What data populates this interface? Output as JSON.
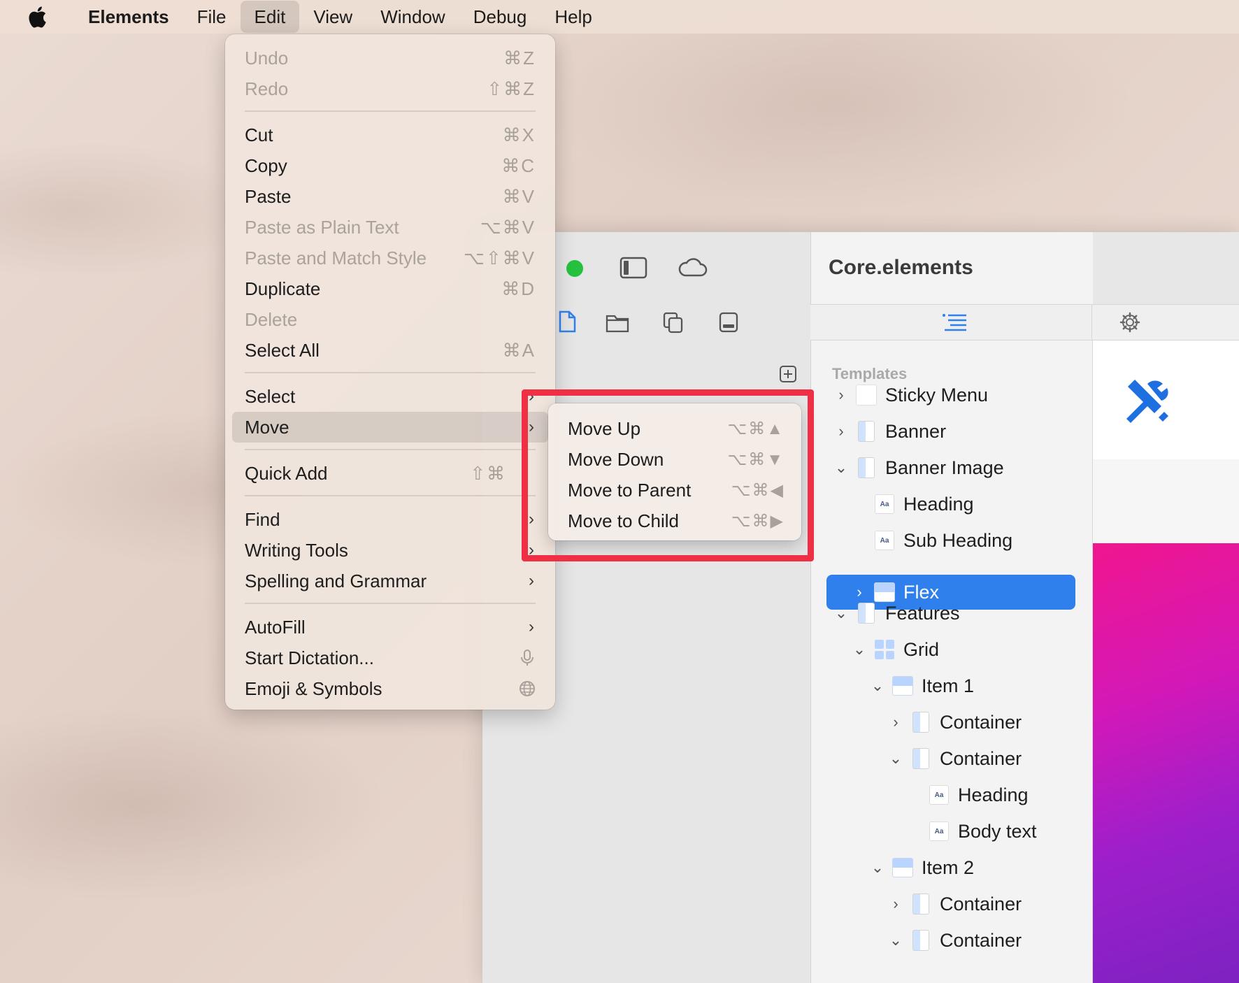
{
  "menubar": {
    "app_name": "Elements",
    "items": [
      "File",
      "Edit",
      "View",
      "Window",
      "Debug",
      "Help"
    ],
    "active": "Edit"
  },
  "edit_menu": {
    "undo": {
      "label": "Undo",
      "shortcut": "⌘Z"
    },
    "redo": {
      "label": "Redo",
      "shortcut": "⇧⌘Z"
    },
    "cut": {
      "label": "Cut",
      "shortcut": "⌘X"
    },
    "copy": {
      "label": "Copy",
      "shortcut": "⌘C"
    },
    "paste": {
      "label": "Paste",
      "shortcut": "⌘V"
    },
    "paste_plain": {
      "label": "Paste as Plain Text",
      "shortcut": "⌥⌘V"
    },
    "paste_match": {
      "label": "Paste and Match Style",
      "shortcut": "⌥⇧⌘V"
    },
    "duplicate": {
      "label": "Duplicate",
      "shortcut": "⌘D"
    },
    "delete": {
      "label": "Delete"
    },
    "select_all": {
      "label": "Select All",
      "shortcut": "⌘A"
    },
    "select": {
      "label": "Select"
    },
    "move": {
      "label": "Move"
    },
    "quick_add": {
      "label": "Quick Add",
      "shortcut": "⇧⌘"
    },
    "find": {
      "label": "Find"
    },
    "writing_tools": {
      "label": "Writing Tools"
    },
    "spelling": {
      "label": "Spelling and Grammar"
    },
    "autofill": {
      "label": "AutoFill"
    },
    "dictation": {
      "label": "Start Dictation..."
    },
    "emoji": {
      "label": "Emoji & Symbols"
    }
  },
  "move_submenu": {
    "move_up": {
      "label": "Move Up",
      "shortcut": "⌥⌘▲"
    },
    "move_down": {
      "label": "Move Down",
      "shortcut": "⌥⌘▼"
    },
    "move_to_parent": {
      "label": "Move to Parent",
      "shortcut": "⌥⌘◀"
    },
    "move_to_child": {
      "label": "Move to Child",
      "shortcut": "⌥⌘▶"
    }
  },
  "window": {
    "project_title": "Core.elements",
    "section_label": "Templates",
    "tree": [
      {
        "label": "Sticky Menu",
        "depth": 0,
        "chevron": "›",
        "icon": "menu-block-icon"
      },
      {
        "label": "Banner",
        "depth": 0,
        "chevron": "›",
        "icon": "block-icon"
      },
      {
        "label": "Banner Image",
        "depth": 0,
        "chevron": "⌄",
        "icon": "block-icon"
      },
      {
        "label": "Heading",
        "depth": 1,
        "chevron": "",
        "icon": "text-icon"
      },
      {
        "label": "Sub Heading",
        "depth": 1,
        "chevron": "",
        "icon": "text-icon"
      },
      {
        "label": "Flex",
        "depth": 1,
        "chevron": "›",
        "icon": "row-icon",
        "selected": true
      },
      {
        "label": "Features",
        "depth": 0,
        "chevron": "⌄",
        "icon": "block-icon"
      },
      {
        "label": "Grid",
        "depth": 1,
        "chevron": "⌄",
        "icon": "grid-icon"
      },
      {
        "label": "Item 1",
        "depth": 2,
        "chevron": "⌄",
        "icon": "row-icon"
      },
      {
        "label": "Container",
        "depth": 3,
        "chevron": "›",
        "icon": "block-icon"
      },
      {
        "label": "Container",
        "depth": 3,
        "chevron": "⌄",
        "icon": "block-icon"
      },
      {
        "label": "Heading",
        "depth": 4,
        "chevron": "",
        "icon": "text-icon"
      },
      {
        "label": "Body text",
        "depth": 4,
        "chevron": "",
        "icon": "text-icon"
      },
      {
        "label": "Item 2",
        "depth": 2,
        "chevron": "⌄",
        "icon": "row-icon"
      },
      {
        "label": "Container",
        "depth": 3,
        "chevron": "›",
        "icon": "block-icon"
      },
      {
        "label": "Container",
        "depth": 3,
        "chevron": "⌄",
        "icon": "block-icon"
      }
    ]
  },
  "colors": {
    "accent": "#2f80ed",
    "highlight_box": "#ee2f44",
    "traffic_green": "#27c13f"
  }
}
